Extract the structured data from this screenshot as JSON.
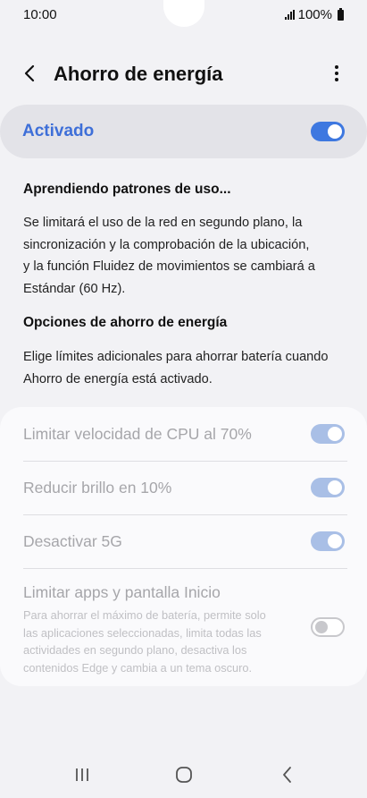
{
  "status": {
    "time": "10:00",
    "battery": "100%"
  },
  "header": {
    "title": "Ahorro de energía"
  },
  "master": {
    "label": "Activado",
    "on": true
  },
  "learning": {
    "title": "Aprendiendo patrones de uso...",
    "lines": [
      "Se limitará el uso de la red en segundo plano, la",
      "sincronización y la comprobación de la ubicación,",
      "y la función Fluidez de movimientos se cambiará a",
      "Estándar (60 Hz)."
    ]
  },
  "options": {
    "title": "Opciones de ahorro de energía",
    "lines": [
      "Elige límites adicionales para ahorrar batería cuando",
      "Ahorro de energía está activado."
    ]
  },
  "settings": [
    {
      "label": "Limitar velocidad de CPU al 70%",
      "on": true
    },
    {
      "label": "Reducir brillo en 10%",
      "on": true
    },
    {
      "label": "Desactivar 5G",
      "on": true
    },
    {
      "label": "Limitar apps y pantalla Inicio",
      "on": false,
      "desc_lines": [
        "Para ahorrar el máximo de batería, permite solo",
        "las aplicaciones seleccionadas, limita todas las",
        "actividades en segundo plano, desactiva los",
        "contenidos Edge y cambia a un tema oscuro."
      ]
    }
  ],
  "icons": {
    "back": "back-arrow-icon",
    "more": "more-vertical-icon",
    "recents": "recents-icon",
    "home": "home-icon",
    "nav_back": "nav-back-icon"
  },
  "colors": {
    "accent": "#3e78e0",
    "accent_text": "#3e6fd8"
  }
}
